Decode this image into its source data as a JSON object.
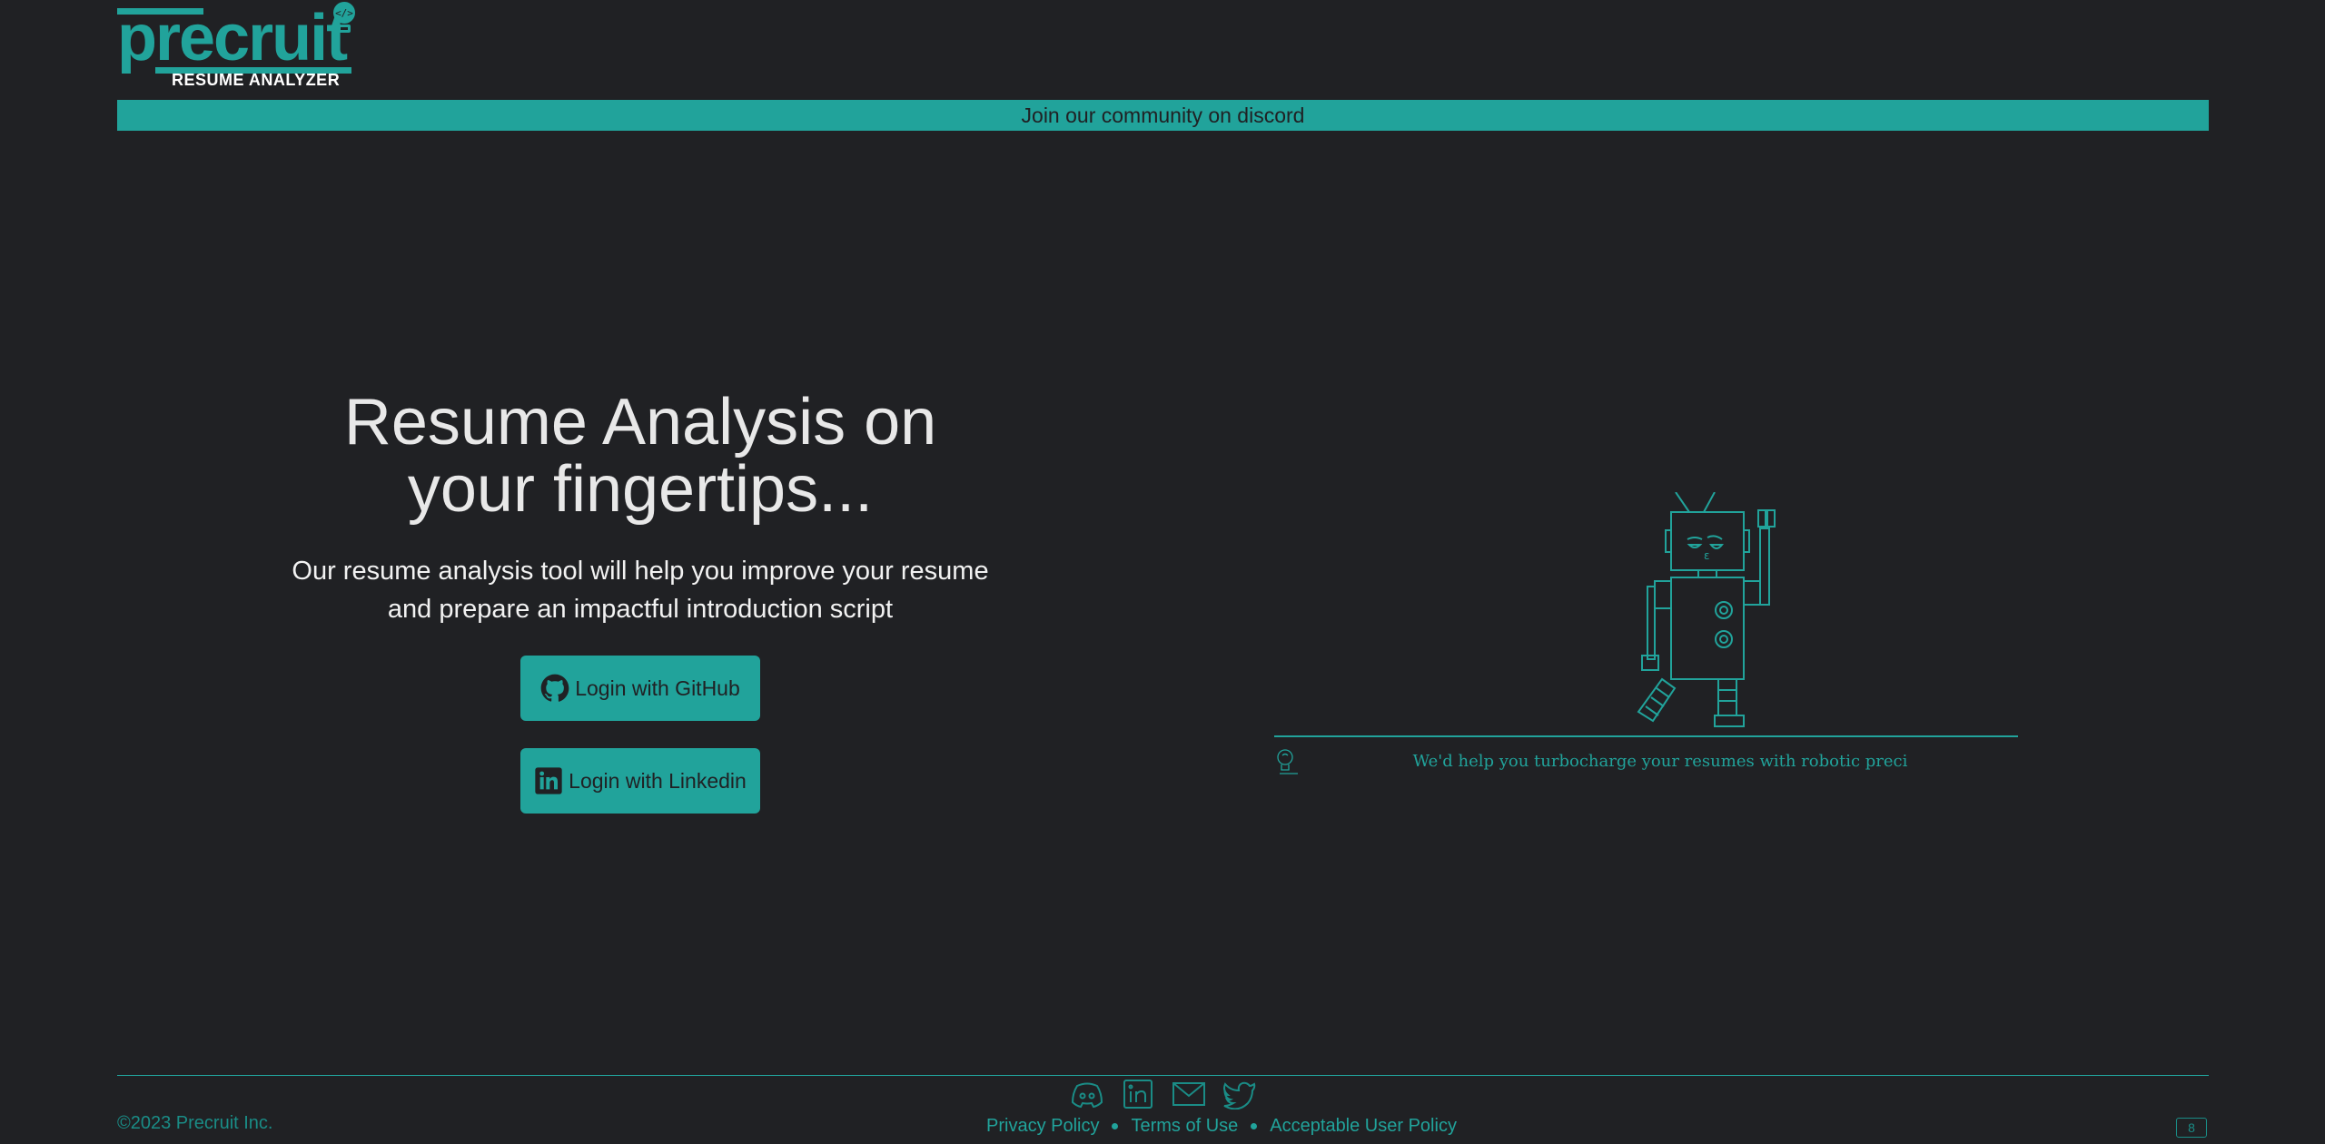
{
  "logo": {
    "wordmark": "precruit",
    "subtitle": "RESUME ANALYZER"
  },
  "banner": {
    "text": "Join our community on discord"
  },
  "hero": {
    "title_line1": "Resume Analysis on",
    "title_line2": "your fingertips...",
    "sub_line1": "Our resume analysis tool will help you improve your resume",
    "sub_line2": "and prepare an impactful introduction script"
  },
  "auth": {
    "github_label": "Login with GitHub",
    "linkedin_label": "Login with Linkedin"
  },
  "illustration": {
    "tagline": "We'd help you turbocharge your resumes with robotic preci"
  },
  "footer": {
    "copyright": "©2023 Precruit Inc.",
    "links": [
      "Privacy Policy",
      "Terms of Use",
      "Acceptable User Policy"
    ],
    "icons": [
      "discord-icon",
      "linkedin-icon",
      "mail-icon",
      "twitter-icon"
    ],
    "version": "8"
  },
  "colors": {
    "background": "#202124",
    "accent": "#21a39b",
    "text": "#e8e8e8"
  }
}
